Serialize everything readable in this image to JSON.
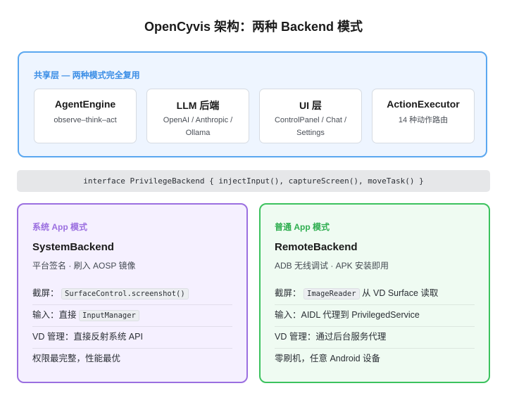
{
  "title": "OpenCyvis 架构：两种 Backend 模式",
  "shared": {
    "label": "共享层 — 两种模式完全复用",
    "cards": [
      {
        "title": "AgentEngine",
        "sub": "observe–think–act"
      },
      {
        "title": "LLM 后端",
        "sub": "OpenAI / Anthropic / Ollama"
      },
      {
        "title": "UI 层",
        "sub": "ControlPanel / Chat / Settings"
      },
      {
        "title": "ActionExecutor",
        "sub": "14 种动作路由"
      }
    ]
  },
  "interface_line": "interface PrivilegeBackend { injectInput(), captureScreen(), moveTask() }",
  "system_mode": {
    "tag": "系统 App 模式",
    "name": "SystemBackend",
    "desc": "平台签名 · 刷入 AOSP 镜像",
    "rows": {
      "screenshot_label": "截屏：",
      "screenshot_code": "SurfaceControl.screenshot()",
      "input_label": "输入：直接",
      "input_code": "InputManager",
      "vd": "VD 管理：直接反射系统 API",
      "perm": "权限最完整，性能最优"
    }
  },
  "normal_mode": {
    "tag": "普通 App 模式",
    "name": "RemoteBackend",
    "desc": "ADB 无线调试 · APK 安装即用",
    "rows": {
      "screenshot_label": "截屏：",
      "screenshot_code": "ImageReader",
      "screenshot_suffix": "从 VD Surface 读取",
      "input": "输入：AIDL 代理到 PrivilegedService",
      "vd": "VD 管理：通过后台服务代理",
      "flash": "零刷机，任意 Android 设备"
    }
  },
  "colors": {
    "shared_border": "#5aa7f0",
    "system_border": "#9b6fe0",
    "normal_border": "#3cc25e"
  }
}
